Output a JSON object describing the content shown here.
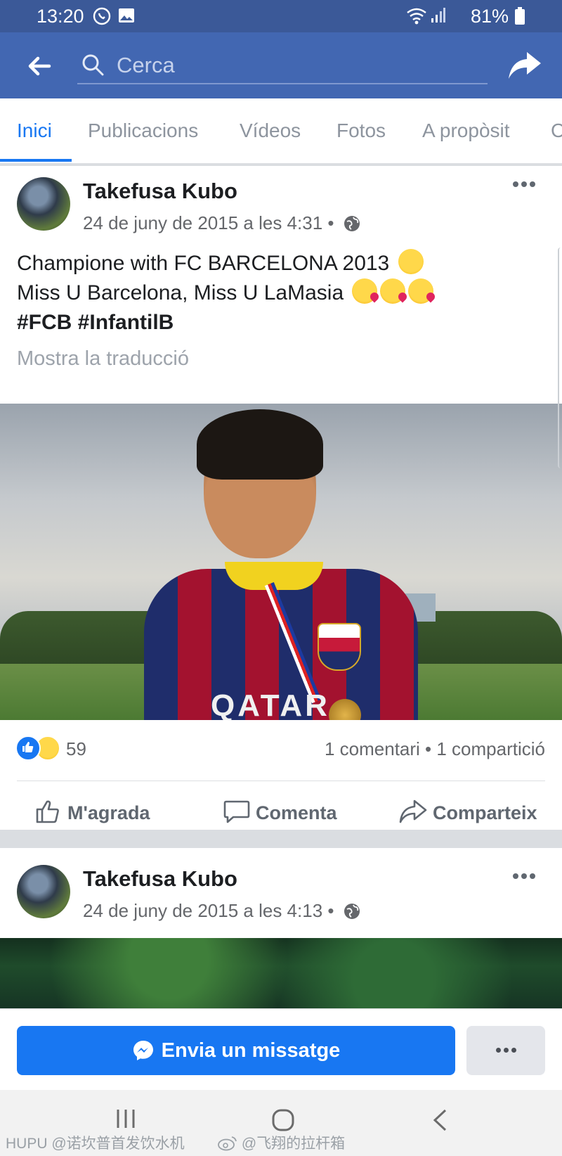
{
  "status_bar": {
    "time": "13:20",
    "battery": "81%"
  },
  "search": {
    "placeholder": "Cerca"
  },
  "tabs": [
    {
      "label": "Inici",
      "active": true
    },
    {
      "label": "Publicacions"
    },
    {
      "label": "Vídeos"
    },
    {
      "label": "Fotos"
    },
    {
      "label": "A propòsit"
    },
    {
      "label": "C"
    }
  ],
  "post1": {
    "author": "Takefusa Kubo",
    "timestamp": "24 de juny de 2015 a les 4:31 •",
    "text_line1": "Champione with FC BARCELONA 2013",
    "text_line2": "Miss U Barcelona, Miss U LaMasia",
    "hashtags": "#FCB #InfantilB",
    "translate_link": "Mostra la traducció",
    "photo_text": "QATAR",
    "reaction_count": "59",
    "comments_shares": "1 comentari • 1 compartició",
    "actions": {
      "like": "M'agrada",
      "comment": "Comenta",
      "share": "Comparteix"
    }
  },
  "post2": {
    "author": "Takefusa Kubo",
    "timestamp": "24 de juny de 2015 a les 4:13 •"
  },
  "message_bar": {
    "send_label": "Envia un missatge"
  },
  "watermark": {
    "left": "HUPU @诺坎普首发饮水机",
    "center": "@飞翔的拉杆箱"
  },
  "colors": {
    "brand": "#4267b2",
    "status_bar": "#3b5998",
    "accent": "#1877f2"
  }
}
